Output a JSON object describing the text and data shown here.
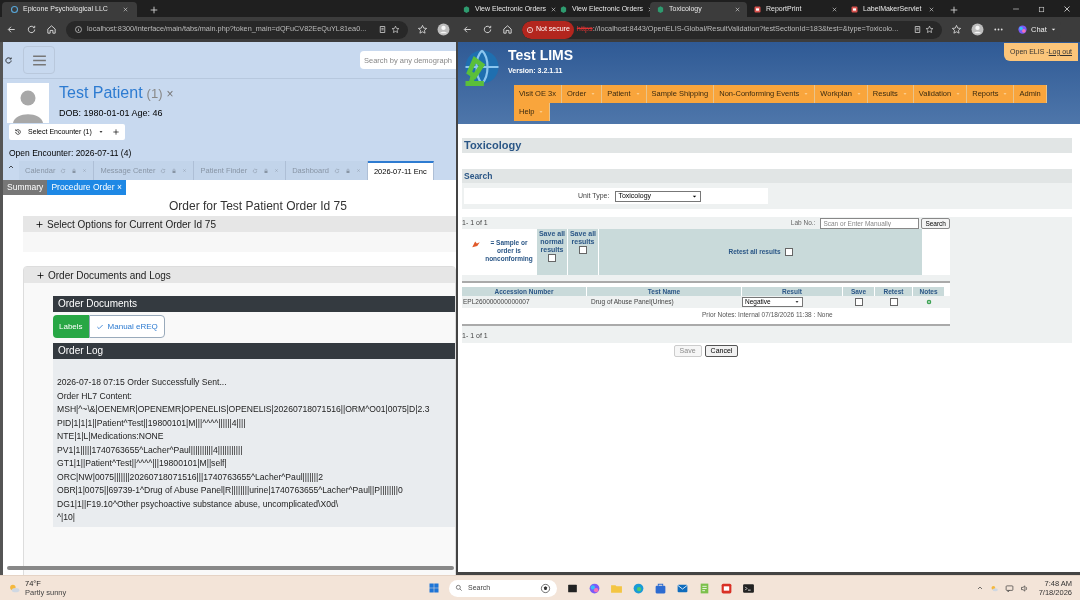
{
  "left_window": {
    "tabs": [
      {
        "title": "Epicone Psychological LLC",
        "selected": true
      }
    ],
    "address": "localhost:8300/interface/main/tabs/main.php?token_main=dQFuCV82EeQuYL81ea0...",
    "search": {
      "placeholder": "Search by any demograph"
    },
    "patient": {
      "name": "Test Patient",
      "count": "(1)",
      "close": "×",
      "dob": "DOB: 1980-01-01 Age: 46"
    },
    "encounter_button": {
      "label": "Select Encounter",
      "count": "(1)"
    },
    "open_encounter": "Open Encounter: 2026-07-11 (4)",
    "app_tabs": [
      {
        "label": "Calendar",
        "selected": false
      },
      {
        "label": "Message Center",
        "selected": false
      },
      {
        "label": "Patient Finder",
        "selected": false
      },
      {
        "label": "Dashboard",
        "selected": false
      },
      {
        "label": "2026-07-11 Enc",
        "selected": true
      }
    ],
    "sub_tabs": [
      {
        "label": "Summary",
        "selected": false
      },
      {
        "label": "Procedure Order ×",
        "selected": true
      }
    ],
    "order_title": "Order for Test Patient Order Id 75",
    "sections": [
      "Select Options for Current Order Id 75",
      "Order Documents and Logs"
    ],
    "order_documents": {
      "title": "Order Documents",
      "buttons": [
        {
          "label": "Labels",
          "kind": "solid"
        },
        {
          "label": "Manual eREQ",
          "kind": "outline"
        }
      ]
    },
    "order_log": {
      "title": "Order Log",
      "lines": [
        "2026-07-18 07:15 Order Successfully Sent...",
        "Order HL7 Content:",
        "MSH|^~\\&|OENEMR|OPENEMR|OPENELIS|OPENELIS|20260718071516||ORM^O01|0075|D|2.3",
        "PID|1|1|1||Patient^Test||19800101|M|||^^^^||||||4||||",
        "NTE|1|L|Medications:NONE",
        "PV1|1|||||1740763655^Lacher^Paul||||||||||4|||||||||||",
        "GT1|1||Patient^Test||^^^^|||19800101|M||self|",
        "ORC|NW|0075|||||||20260718071516|||1740763655^Lacher^Paul|||||||2",
        "OBR|1|0075||69739-1^Drug of Abuse Panel|R||||||||urine|1740763655^Lacher^Paul||P||||||||0",
        "DG1|1||F19.10^Other psychoactive substance abuse, uncomplicated\\X0d\\",
        "^|10|"
      ]
    }
  },
  "right_window": {
    "tabs": [
      {
        "title": "View Electronic Orders",
        "selected": false,
        "kind": "lims"
      },
      {
        "title": "View Electronic Orders",
        "selected": false,
        "kind": "lims"
      },
      {
        "title": "Toxicology",
        "selected": true,
        "kind": "lims"
      },
      {
        "title": "ReportPrint",
        "selected": false,
        "kind": "report"
      },
      {
        "title": "LabelMakerServlet",
        "selected": false,
        "kind": "report"
      }
    ],
    "security": "Not secure",
    "address_scheme": "https",
    "address": "://localhost:8443/OpenELIS-Global/ResultValidation?testSectionId=183&test=&type=Toxicolo...",
    "chat": "Chat",
    "app": {
      "title": "Test LIMS",
      "version": "Version: 3.2.1.11"
    },
    "login": {
      "label": "Open ELIS - ",
      "link": "Log out"
    },
    "menu": [
      {
        "label": "Visit OE 3x",
        "dropdown": false
      },
      {
        "label": "Order",
        "dropdown": true
      },
      {
        "label": "Patient",
        "dropdown": true
      },
      {
        "label": "Sample Shipping",
        "dropdown": false
      },
      {
        "label": "Non-Conforming Events",
        "dropdown": true
      },
      {
        "label": "Workplan",
        "dropdown": true
      },
      {
        "label": "Results",
        "dropdown": true
      },
      {
        "label": "Validation",
        "dropdown": true
      },
      {
        "label": "Reports",
        "dropdown": true
      },
      {
        "label": "Admin",
        "dropdown": false
      },
      {
        "label": "Help",
        "dropdown": true
      }
    ],
    "page_title": "Toxicology",
    "search_heading": "Search",
    "unit_type": {
      "label": "Unit Type:",
      "value": "Toxicology"
    },
    "paging_top": "1- 1 of 1",
    "paging_bottom": "1- 1 of 1",
    "lab_no": {
      "label": "Lab No.:",
      "placeholder": "Scan or Enter Manually"
    },
    "search_button": "Search",
    "legend": "= Sample or order is nonconforming",
    "bulk": [
      {
        "label": "Save all normal results",
        "checked": false
      },
      {
        "label": "Save all results",
        "checked": false
      },
      {
        "label": "Retest all results",
        "checked": false
      }
    ],
    "columns": [
      "Accession Number",
      "Test Name",
      "Result",
      "Save",
      "Retest",
      "Notes"
    ],
    "rows": [
      {
        "accession": "EPL260000000000007",
        "test_name": "Drug of Abuse Panel(Urines)",
        "result": "Negative",
        "save": false,
        "retest": false
      }
    ],
    "prior_notes": "Prior Notes: Internal 07/18/2026 11:38 : None",
    "buttons": [
      {
        "label": "Save",
        "disabled": true
      },
      {
        "label": "Cancel",
        "disabled": false
      }
    ]
  },
  "taskbar": {
    "weather": {
      "temp": "74°F",
      "condition": "Partly sunny"
    },
    "search": "Search",
    "time": "7:48 AM",
    "date": "7/18/2026"
  }
}
